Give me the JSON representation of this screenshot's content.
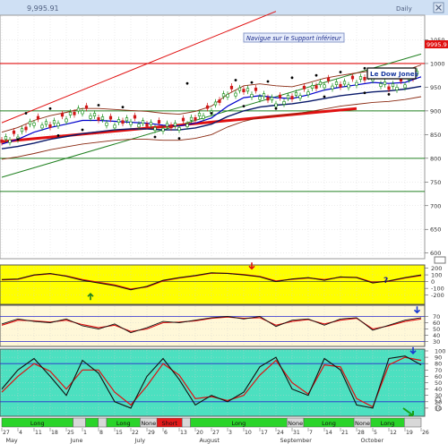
{
  "window": {
    "title_value": "9,995.91",
    "period_label": "Daily",
    "close_icon": "close-icon"
  },
  "annotations": {
    "support_note": "Navigue sur le Support inférieur",
    "index_label": "Le Dow Jones"
  },
  "colors": {
    "bar_up": "#0a8a0a",
    "bar_down": "#d01818",
    "ma_blue": "#0000cc",
    "ma_dark": "#0a1a6a",
    "envelope": "#8a2a12",
    "trend_red": "#e01010",
    "trend_green": "#208020",
    "osc_bg_yellow": "#ffff00",
    "osc_bg_cream": "#fff8d8",
    "osc_bg_teal": "#4ce0c0",
    "signal_long": "#2ad42a",
    "signal_none": "#d8d8d8",
    "signal_short": "#e41a1a"
  },
  "chart_data": [
    {
      "id": "price",
      "type": "line",
      "title": "",
      "ylabel": "",
      "ylim": [
        590,
        1100
      ],
      "yticks": [
        600,
        650,
        700,
        750,
        800,
        850,
        900,
        950,
        1000,
        1050
      ],
      "grid": true,
      "last_value_label": "9995.9",
      "x": [
        0,
        4,
        8,
        12,
        16,
        20,
        24,
        28,
        32,
        36,
        40,
        44,
        48,
        52,
        56,
        60,
        64,
        68,
        72,
        76,
        80,
        84,
        88,
        92,
        96,
        100,
        104
      ],
      "series": [
        {
          "role": "close",
          "values": [
            838,
            850,
            880,
            870,
            888,
            905,
            885,
            875,
            882,
            872,
            868,
            870,
            885,
            905,
            940,
            945,
            935,
            920,
            930,
            945,
            960,
            955,
            965,
            975,
            950,
            960,
            985
          ]
        },
        {
          "role": "ma_fast",
          "values": [
            830,
            840,
            855,
            865,
            872,
            880,
            880,
            878,
            876,
            874,
            870,
            868,
            874,
            885,
            910,
            928,
            932,
            928,
            926,
            934,
            944,
            950,
            955,
            960,
            958,
            960,
            972
          ]
        },
        {
          "role": "ma_slow",
          "values": [
            820,
            825,
            832,
            840,
            846,
            852,
            856,
            860,
            862,
            862,
            860,
            860,
            864,
            872,
            888,
            900,
            908,
            912,
            915,
            920,
            926,
            932,
            936,
            940,
            942,
            946,
            952
          ]
        }
      ],
      "markers_above": [
        [
          6,
          895
        ],
        [
          12,
          905
        ],
        [
          24,
          912
        ],
        [
          30,
          908
        ],
        [
          46,
          958
        ],
        [
          58,
          965
        ],
        [
          62,
          960
        ],
        [
          66,
          962
        ],
        [
          72,
          970
        ],
        [
          78,
          975
        ],
        [
          84,
          982
        ],
        [
          90,
          990
        ],
        [
          94,
          985
        ]
      ],
      "markers_below": [
        [
          4,
          840
        ],
        [
          14,
          848
        ],
        [
          20,
          860
        ],
        [
          38,
          845
        ],
        [
          44,
          842
        ],
        [
          52,
          895
        ],
        [
          60,
          910
        ],
        [
          68,
          905
        ],
        [
          80,
          930
        ],
        [
          90,
          938
        ],
        [
          96,
          935
        ]
      ],
      "reference_lines": [
        1000,
        900,
        800,
        730
      ]
    },
    {
      "id": "osc1",
      "type": "line",
      "title": "",
      "ylabel": "",
      "ylim": [
        -310,
        220
      ],
      "yticks": [
        200,
        100,
        0,
        -100,
        -200
      ],
      "grid": true,
      "x": [
        0,
        4,
        8,
        12,
        16,
        20,
        24,
        28,
        32,
        36,
        40,
        44,
        48,
        52,
        56,
        60,
        64,
        68,
        72,
        76,
        80,
        84,
        88,
        92,
        96,
        100,
        104
      ],
      "series": [
        {
          "role": "main",
          "values": [
            30,
            40,
            100,
            120,
            80,
            20,
            -20,
            -60,
            -120,
            -70,
            20,
            60,
            90,
            130,
            120,
            100,
            70,
            0,
            40,
            60,
            20,
            70,
            60,
            -20,
            10,
            60,
            100
          ]
        },
        {
          "role": "signal",
          "values": [
            25,
            35,
            95,
            115,
            85,
            30,
            -10,
            -50,
            -110,
            -80,
            10,
            55,
            85,
            125,
            122,
            105,
            75,
            10,
            35,
            55,
            30,
            65,
            62,
            -10,
            5,
            55,
            90
          ]
        }
      ],
      "arrows": [
        {
          "x": 22,
          "y": -180,
          "dir": "up"
        },
        {
          "x": 62,
          "y": 190,
          "dir": "down"
        }
      ],
      "question_mark": "?"
    },
    {
      "id": "osc2",
      "type": "line",
      "title": "",
      "ylabel": "",
      "ylim": [
        25,
        85
      ],
      "yticks": [
        70,
        60,
        50,
        40,
        30
      ],
      "reference_lines": [
        70,
        30
      ],
      "grid": true,
      "x": [
        0,
        4,
        8,
        12,
        16,
        20,
        24,
        28,
        32,
        36,
        40,
        44,
        48,
        52,
        56,
        60,
        64,
        68,
        72,
        76,
        80,
        84,
        88,
        92,
        96,
        100,
        104
      ],
      "series": [
        {
          "role": "main",
          "values": [
            58,
            66,
            62,
            60,
            66,
            55,
            50,
            58,
            44,
            52,
            62,
            60,
            64,
            68,
            70,
            66,
            70,
            54,
            64,
            66,
            56,
            66,
            68,
            48,
            56,
            64,
            68
          ]
        },
        {
          "role": "signal",
          "values": [
            56,
            64,
            63,
            61,
            64,
            57,
            52,
            56,
            46,
            50,
            60,
            61,
            63,
            67,
            69,
            67,
            68,
            56,
            62,
            65,
            58,
            64,
            67,
            50,
            55,
            62,
            66
          ]
        }
      ],
      "arrows": [
        {
          "x": 103,
          "y": 76,
          "dir": "down"
        }
      ]
    },
    {
      "id": "stochastic",
      "type": "line",
      "title": "",
      "ylabel": "",
      "ylim": [
        0,
        100
      ],
      "yticks": [
        100,
        90,
        80,
        70,
        60,
        50,
        40,
        30,
        20,
        10
      ],
      "reference_lines": [
        80,
        20
      ],
      "grid": true,
      "x": [
        0,
        4,
        8,
        12,
        16,
        20,
        24,
        28,
        32,
        36,
        40,
        44,
        48,
        52,
        56,
        60,
        64,
        68,
        72,
        76,
        80,
        84,
        88,
        92,
        96,
        100,
        104
      ],
      "series": [
        {
          "role": "k",
          "values": [
            40,
            70,
            88,
            60,
            30,
            85,
            65,
            20,
            10,
            60,
            88,
            55,
            15,
            30,
            20,
            35,
            75,
            90,
            40,
            30,
            88,
            70,
            15,
            10,
            88,
            92,
            78
          ]
        },
        {
          "role": "d",
          "values": [
            35,
            60,
            80,
            68,
            40,
            70,
            70,
            35,
            15,
            45,
            80,
            62,
            25,
            28,
            22,
            30,
            62,
            85,
            50,
            32,
            78,
            75,
            25,
            12,
            78,
            90,
            85
          ]
        }
      ],
      "arrows": [
        {
          "x": 102,
          "y": 96,
          "dir": "down"
        }
      ]
    }
  ],
  "signal_strip": {
    "segments": [
      {
        "state": "long",
        "label": "Long",
        "from": 0,
        "to": 17
      },
      {
        "state": "none",
        "label": "",
        "from": 17,
        "to": 20
      },
      {
        "state": "long",
        "label": "",
        "from": 20,
        "to": 23
      },
      {
        "state": "none",
        "label": "",
        "from": 23,
        "to": 25
      },
      {
        "state": "long",
        "label": "Long",
        "from": 25,
        "to": 33
      },
      {
        "state": "none",
        "label": "None",
        "from": 33,
        "to": 37
      },
      {
        "state": "short",
        "label": "Short",
        "from": 37,
        "to": 43
      },
      {
        "state": "none",
        "label": "",
        "from": 43,
        "to": 45
      },
      {
        "state": "long",
        "label": "Long",
        "from": 45,
        "to": 68
      },
      {
        "state": "none",
        "label": "None",
        "from": 68,
        "to": 72
      },
      {
        "state": "long",
        "label": "Long",
        "from": 72,
        "to": 84
      },
      {
        "state": "none",
        "label": "None",
        "from": 84,
        "to": 88
      },
      {
        "state": "long",
        "label": "Long",
        "from": 88,
        "to": 96
      },
      {
        "state": "none",
        "label": "",
        "from": 96,
        "to": 100
      }
    ]
  },
  "x_axis": {
    "day_labels": [
      "27",
      "4",
      "11",
      "18",
      "25",
      "1",
      "8",
      "15",
      "22",
      "29",
      "6",
      "13",
      "20",
      "27",
      "3",
      "10",
      "17",
      "24",
      "31",
      "7",
      "14",
      "21",
      "28",
      "5",
      "12",
      "19",
      "26"
    ],
    "month_labels": [
      {
        "label": "May",
        "at": 0
      },
      {
        "label": "June",
        "at": 4
      },
      {
        "label": "July",
        "at": 8
      },
      {
        "label": "August",
        "at": 12
      },
      {
        "label": "September",
        "at": 17
      },
      {
        "label": "October",
        "at": 22
      }
    ]
  },
  "icons": {
    "zoom_in": "zoom-in-icon",
    "zoom_out": "zoom-out-icon",
    "scale_toggle": "scale-toggle-icon",
    "trend_arrow": "trend-arrow-icon"
  }
}
